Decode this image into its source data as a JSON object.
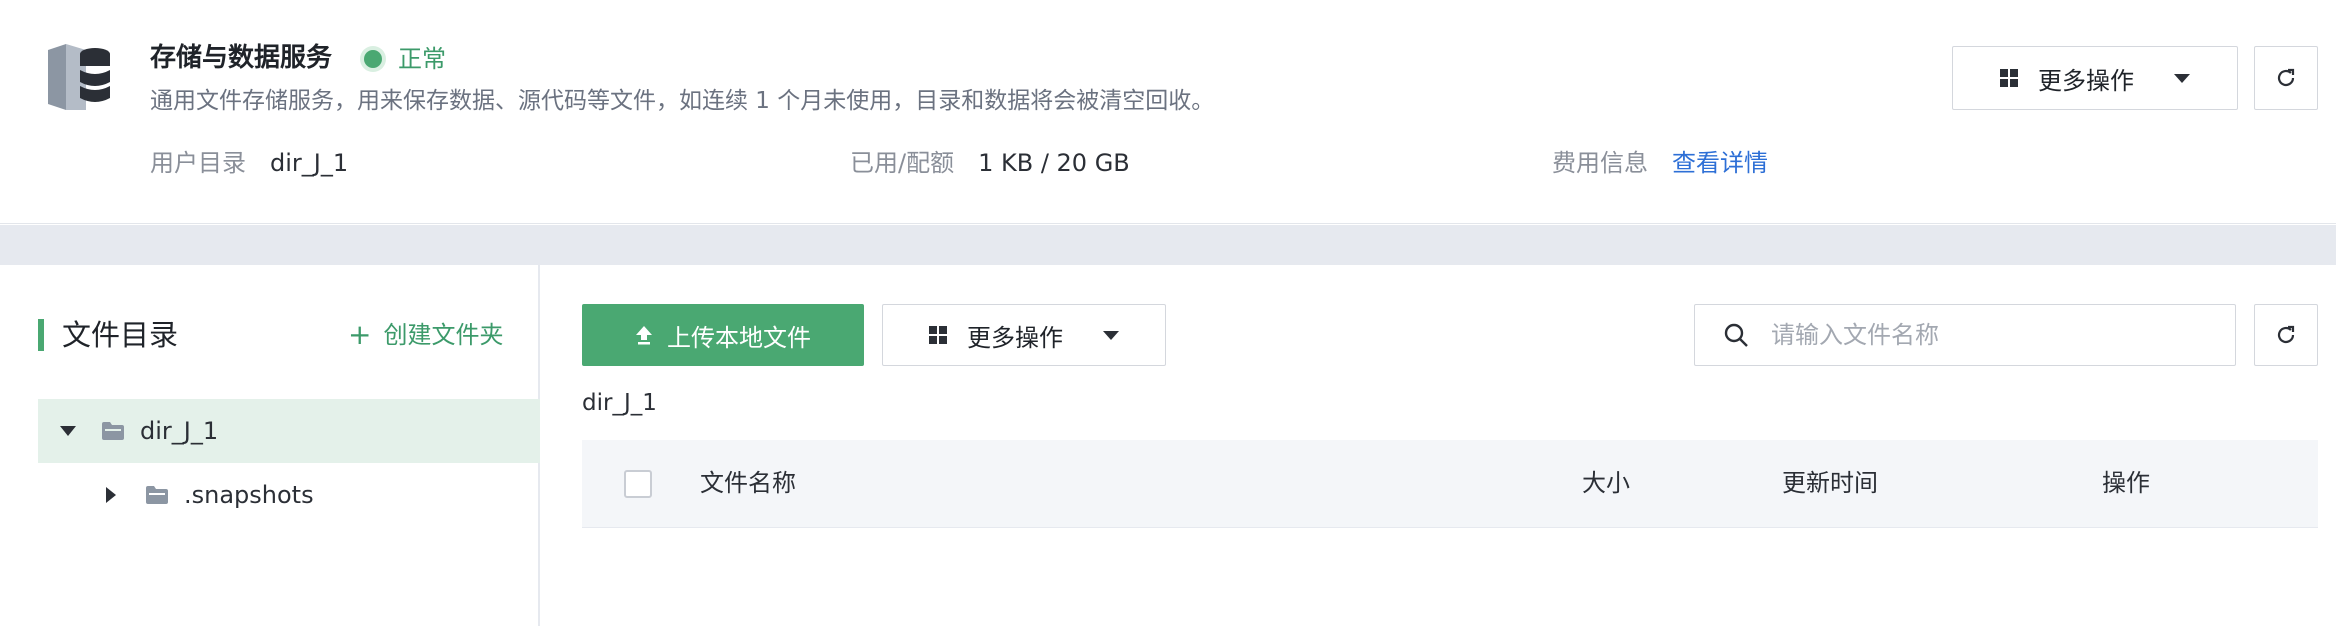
{
  "service": {
    "icon": "database-storage-icon",
    "title": "存储与数据服务",
    "status": "正常",
    "status_color": "#4aa872",
    "description": "通用文件存储服务，用来保存数据、源代码等文件，如连续 1 个月未使用，目录和数据将会被清空回收。",
    "user_dir_label": "用户目录",
    "user_dir_value": "dir_J_1",
    "quota_label": "已用/配额",
    "quota_value": "1 KB / 20 GB",
    "fee_label": "费用信息",
    "fee_link": "查看详情"
  },
  "header_actions": {
    "more_label": "更多操作",
    "refresh_icon": "refresh-icon"
  },
  "sidebar": {
    "title": "文件目录",
    "create_folder": "创建文件夹",
    "tree": [
      {
        "label": "dir_J_1",
        "expanded": true,
        "selected": true
      },
      {
        "label": ".snapshots",
        "expanded": false,
        "selected": false
      }
    ]
  },
  "toolbar": {
    "upload_label": "上传本地文件",
    "more_label": "更多操作",
    "search_placeholder": "请输入文件名称"
  },
  "breadcrumb": "dir_J_1",
  "table": {
    "columns": [
      "文件名称",
      "大小",
      "更新时间",
      "操作"
    ]
  },
  "colors": {
    "accent": "#4aa872",
    "link": "#2d6fd6",
    "strip": "#e6e9ef",
    "selected_row": "#e4f1ea"
  }
}
